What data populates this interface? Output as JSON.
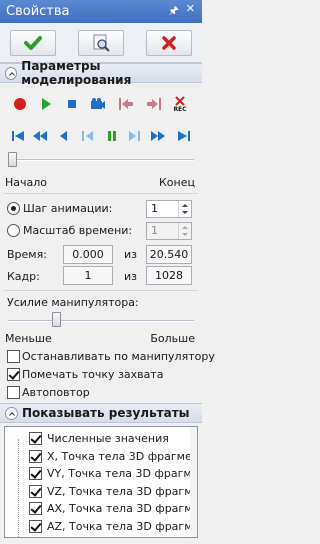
{
  "window": {
    "title": "Свойства",
    "pin_icon": "pin-icon",
    "close_icon": "close-icon"
  },
  "toolbar": {
    "ok_icon": "checkmark-icon",
    "preview_icon": "preview-icon",
    "cancel_icon": "cancel-x-icon"
  },
  "sections": {
    "modeling": "Параметры моделирования",
    "results": "Показывать результаты"
  },
  "controls_row1": [
    "record",
    "play",
    "stop",
    "camera",
    "go-start",
    "go-end",
    "rec"
  ],
  "rec_label": "REC",
  "controls_row2": [
    "to-start",
    "fast-back",
    "step-back",
    "play-back",
    "pause",
    "play-forward",
    "fast-forward",
    "to-end"
  ],
  "timeline": {
    "start_label": "Начало",
    "end_label": "Конец",
    "position": 0.0
  },
  "animation": {
    "step_label": "Шаг анимации:",
    "step_value": "1",
    "scale_label": "Масштаб времени:",
    "scale_value": "1",
    "selected": "step"
  },
  "time": {
    "label": "Время:",
    "current": "0.000",
    "of_label": "из",
    "total": "20.540"
  },
  "frame": {
    "label": "Кадр:",
    "current": "1",
    "of_label": "из",
    "total": "1028"
  },
  "manipulator": {
    "label": "Усилие манипулятора:",
    "less_label": "Меньше",
    "more_label": "Больше",
    "level": 0.25
  },
  "options": [
    {
      "label": "Останавливать по манипулятору",
      "checked": false
    },
    {
      "label": "Помечать точку захвата",
      "checked": true
    },
    {
      "label": "Автоповтор",
      "checked": false
    }
  ],
  "results": [
    {
      "label": "Численные значения",
      "checked": true,
      "indent": 0
    },
    {
      "label": "X, Точка тела 3D фрагме...",
      "checked": true,
      "indent": 1
    },
    {
      "label": "VY, Точка тела 3D фрагм...",
      "checked": true,
      "indent": 1
    },
    {
      "label": "VZ, Точка тела 3D фрагм...",
      "checked": true,
      "indent": 1
    },
    {
      "label": "AX, Точка тела 3D фрагм...",
      "checked": true,
      "indent": 1
    },
    {
      "label": "AZ, Точка тела 3D фрагм...",
      "checked": true,
      "indent": 1
    }
  ],
  "colors": {
    "title_bar": "#4a7bc9",
    "ok_green": "#2e9e2e",
    "cancel_red": "#d42020",
    "media_blue": "#1e6fc8",
    "record_red": "#d81e1e",
    "play_green": "#2aa52a"
  }
}
